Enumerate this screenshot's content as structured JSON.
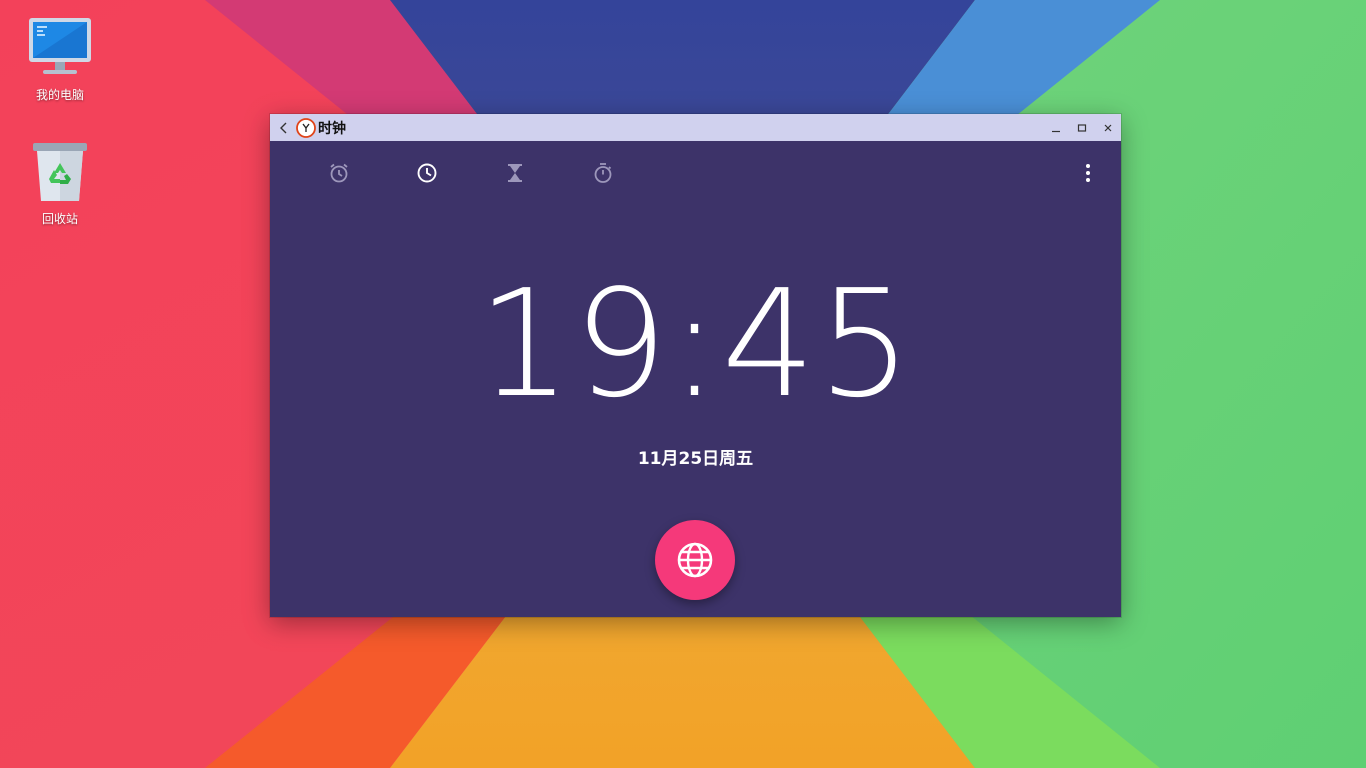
{
  "desktop": {
    "icons": [
      {
        "label": "我的电脑",
        "icon": "computer-icon"
      },
      {
        "label": "回收站",
        "icon": "recycle-bin-icon"
      }
    ]
  },
  "window": {
    "title": "时钟",
    "controls": [
      "minimize",
      "maximize",
      "close"
    ]
  },
  "tabs": [
    {
      "name": "alarm",
      "icon": "alarm-icon",
      "active": false
    },
    {
      "name": "clock",
      "icon": "clock-icon",
      "active": true
    },
    {
      "name": "timer",
      "icon": "hourglass-icon",
      "active": false
    },
    {
      "name": "stopwatch",
      "icon": "stopwatch-icon",
      "active": false
    }
  ],
  "clock": {
    "time": "19:45",
    "date": "11月25日周五"
  },
  "fab": {
    "icon": "globe-icon"
  },
  "colors": {
    "window_background": "#3d3369",
    "titlebar": "#d0d1ee",
    "fab": "#f5397a",
    "active_tab_icon": "#ffffff",
    "inactive_tab_icon": "#9d97bb"
  }
}
